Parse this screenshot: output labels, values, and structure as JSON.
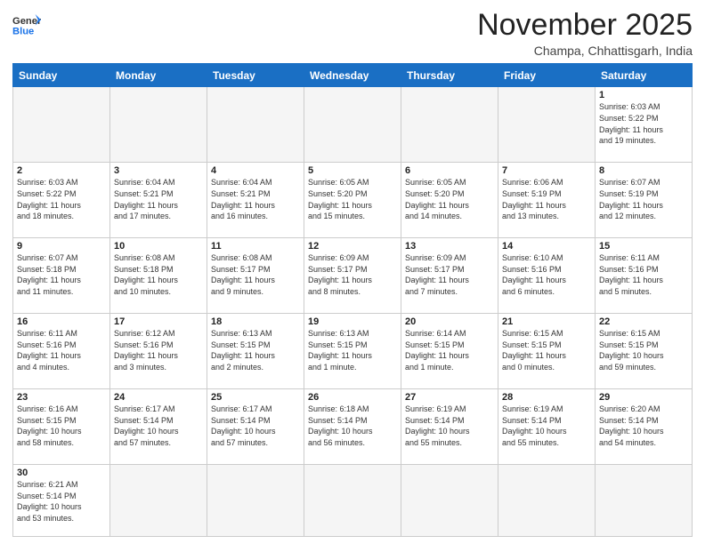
{
  "header": {
    "logo_general": "General",
    "logo_blue": "Blue",
    "month_title": "November 2025",
    "location": "Champa, Chhattisgarh, India"
  },
  "days_of_week": [
    "Sunday",
    "Monday",
    "Tuesday",
    "Wednesday",
    "Thursday",
    "Friday",
    "Saturday"
  ],
  "weeks": [
    [
      {
        "day": "",
        "info": ""
      },
      {
        "day": "",
        "info": ""
      },
      {
        "day": "",
        "info": ""
      },
      {
        "day": "",
        "info": ""
      },
      {
        "day": "",
        "info": ""
      },
      {
        "day": "",
        "info": ""
      },
      {
        "day": "1",
        "info": "Sunrise: 6:03 AM\nSunset: 5:22 PM\nDaylight: 11 hours\nand 19 minutes."
      }
    ],
    [
      {
        "day": "2",
        "info": "Sunrise: 6:03 AM\nSunset: 5:22 PM\nDaylight: 11 hours\nand 18 minutes."
      },
      {
        "day": "3",
        "info": "Sunrise: 6:04 AM\nSunset: 5:21 PM\nDaylight: 11 hours\nand 17 minutes."
      },
      {
        "day": "4",
        "info": "Sunrise: 6:04 AM\nSunset: 5:21 PM\nDaylight: 11 hours\nand 16 minutes."
      },
      {
        "day": "5",
        "info": "Sunrise: 6:05 AM\nSunset: 5:20 PM\nDaylight: 11 hours\nand 15 minutes."
      },
      {
        "day": "6",
        "info": "Sunrise: 6:05 AM\nSunset: 5:20 PM\nDaylight: 11 hours\nand 14 minutes."
      },
      {
        "day": "7",
        "info": "Sunrise: 6:06 AM\nSunset: 5:19 PM\nDaylight: 11 hours\nand 13 minutes."
      },
      {
        "day": "8",
        "info": "Sunrise: 6:07 AM\nSunset: 5:19 PM\nDaylight: 11 hours\nand 12 minutes."
      }
    ],
    [
      {
        "day": "9",
        "info": "Sunrise: 6:07 AM\nSunset: 5:18 PM\nDaylight: 11 hours\nand 11 minutes."
      },
      {
        "day": "10",
        "info": "Sunrise: 6:08 AM\nSunset: 5:18 PM\nDaylight: 11 hours\nand 10 minutes."
      },
      {
        "day": "11",
        "info": "Sunrise: 6:08 AM\nSunset: 5:17 PM\nDaylight: 11 hours\nand 9 minutes."
      },
      {
        "day": "12",
        "info": "Sunrise: 6:09 AM\nSunset: 5:17 PM\nDaylight: 11 hours\nand 8 minutes."
      },
      {
        "day": "13",
        "info": "Sunrise: 6:09 AM\nSunset: 5:17 PM\nDaylight: 11 hours\nand 7 minutes."
      },
      {
        "day": "14",
        "info": "Sunrise: 6:10 AM\nSunset: 5:16 PM\nDaylight: 11 hours\nand 6 minutes."
      },
      {
        "day": "15",
        "info": "Sunrise: 6:11 AM\nSunset: 5:16 PM\nDaylight: 11 hours\nand 5 minutes."
      }
    ],
    [
      {
        "day": "16",
        "info": "Sunrise: 6:11 AM\nSunset: 5:16 PM\nDaylight: 11 hours\nand 4 minutes."
      },
      {
        "day": "17",
        "info": "Sunrise: 6:12 AM\nSunset: 5:16 PM\nDaylight: 11 hours\nand 3 minutes."
      },
      {
        "day": "18",
        "info": "Sunrise: 6:13 AM\nSunset: 5:15 PM\nDaylight: 11 hours\nand 2 minutes."
      },
      {
        "day": "19",
        "info": "Sunrise: 6:13 AM\nSunset: 5:15 PM\nDaylight: 11 hours\nand 1 minute."
      },
      {
        "day": "20",
        "info": "Sunrise: 6:14 AM\nSunset: 5:15 PM\nDaylight: 11 hours\nand 1 minute."
      },
      {
        "day": "21",
        "info": "Sunrise: 6:15 AM\nSunset: 5:15 PM\nDaylight: 11 hours\nand 0 minutes."
      },
      {
        "day": "22",
        "info": "Sunrise: 6:15 AM\nSunset: 5:15 PM\nDaylight: 10 hours\nand 59 minutes."
      }
    ],
    [
      {
        "day": "23",
        "info": "Sunrise: 6:16 AM\nSunset: 5:15 PM\nDaylight: 10 hours\nand 58 minutes."
      },
      {
        "day": "24",
        "info": "Sunrise: 6:17 AM\nSunset: 5:14 PM\nDaylight: 10 hours\nand 57 minutes."
      },
      {
        "day": "25",
        "info": "Sunrise: 6:17 AM\nSunset: 5:14 PM\nDaylight: 10 hours\nand 57 minutes."
      },
      {
        "day": "26",
        "info": "Sunrise: 6:18 AM\nSunset: 5:14 PM\nDaylight: 10 hours\nand 56 minutes."
      },
      {
        "day": "27",
        "info": "Sunrise: 6:19 AM\nSunset: 5:14 PM\nDaylight: 10 hours\nand 55 minutes."
      },
      {
        "day": "28",
        "info": "Sunrise: 6:19 AM\nSunset: 5:14 PM\nDaylight: 10 hours\nand 55 minutes."
      },
      {
        "day": "29",
        "info": "Sunrise: 6:20 AM\nSunset: 5:14 PM\nDaylight: 10 hours\nand 54 minutes."
      }
    ],
    [
      {
        "day": "30",
        "info": "Sunrise: 6:21 AM\nSunset: 5:14 PM\nDaylight: 10 hours\nand 53 minutes."
      },
      {
        "day": "",
        "info": ""
      },
      {
        "day": "",
        "info": ""
      },
      {
        "day": "",
        "info": ""
      },
      {
        "day": "",
        "info": ""
      },
      {
        "day": "",
        "info": ""
      },
      {
        "day": "",
        "info": ""
      }
    ]
  ]
}
